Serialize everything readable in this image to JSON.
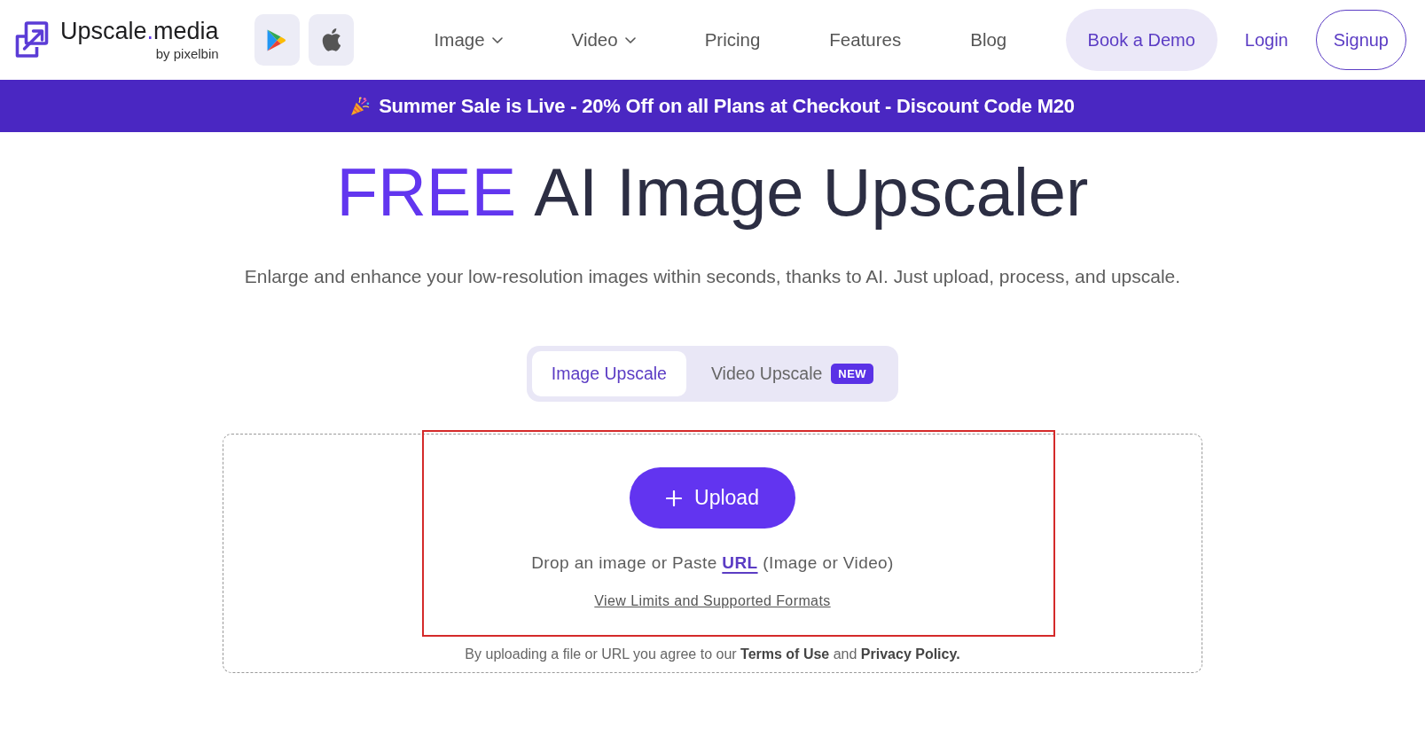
{
  "header": {
    "logo": {
      "name": "Upscale",
      "separator": ".",
      "suffix": "media",
      "tagline": "by pixelbin"
    },
    "app_buttons": [
      {
        "kind": "play"
      },
      {
        "kind": "apple"
      }
    ],
    "nav": [
      {
        "label": "Image",
        "dropdown": true
      },
      {
        "label": "Video",
        "dropdown": true
      },
      {
        "label": "Pricing",
        "dropdown": false
      },
      {
        "label": "Features",
        "dropdown": false
      },
      {
        "label": "Blog",
        "dropdown": false
      }
    ],
    "actions": [
      {
        "label": "Book a Demo",
        "kind": "filled"
      },
      {
        "label": "Login",
        "kind": "text"
      },
      {
        "label": "Signup",
        "kind": "outline"
      }
    ]
  },
  "banner": {
    "text": "Summer Sale is Live - 20% Off on all Plans at Checkout - Discount Code M20"
  },
  "hero": {
    "title_accent": "FREE",
    "title": "AI Image Upscaler",
    "subtitle": "Enlarge and enhance your low-resolution images within seconds, thanks to AI. Just upload, process, and upscale."
  },
  "tabs": [
    {
      "label": "Image Upscale",
      "selected": true
    },
    {
      "label": "Video Upscale",
      "selected": false,
      "badge": "NEW"
    }
  ],
  "upload": {
    "button": "Upload",
    "hint": {
      "before": "Drop an image or Paste",
      "link": "URL",
      "after": "(Image or Video)"
    },
    "limits_link": "View Limits and Supported Formats",
    "consent": "By uploading a file or URL you agree to our **Terms of Use** and **Privacy Policy.**"
  }
}
